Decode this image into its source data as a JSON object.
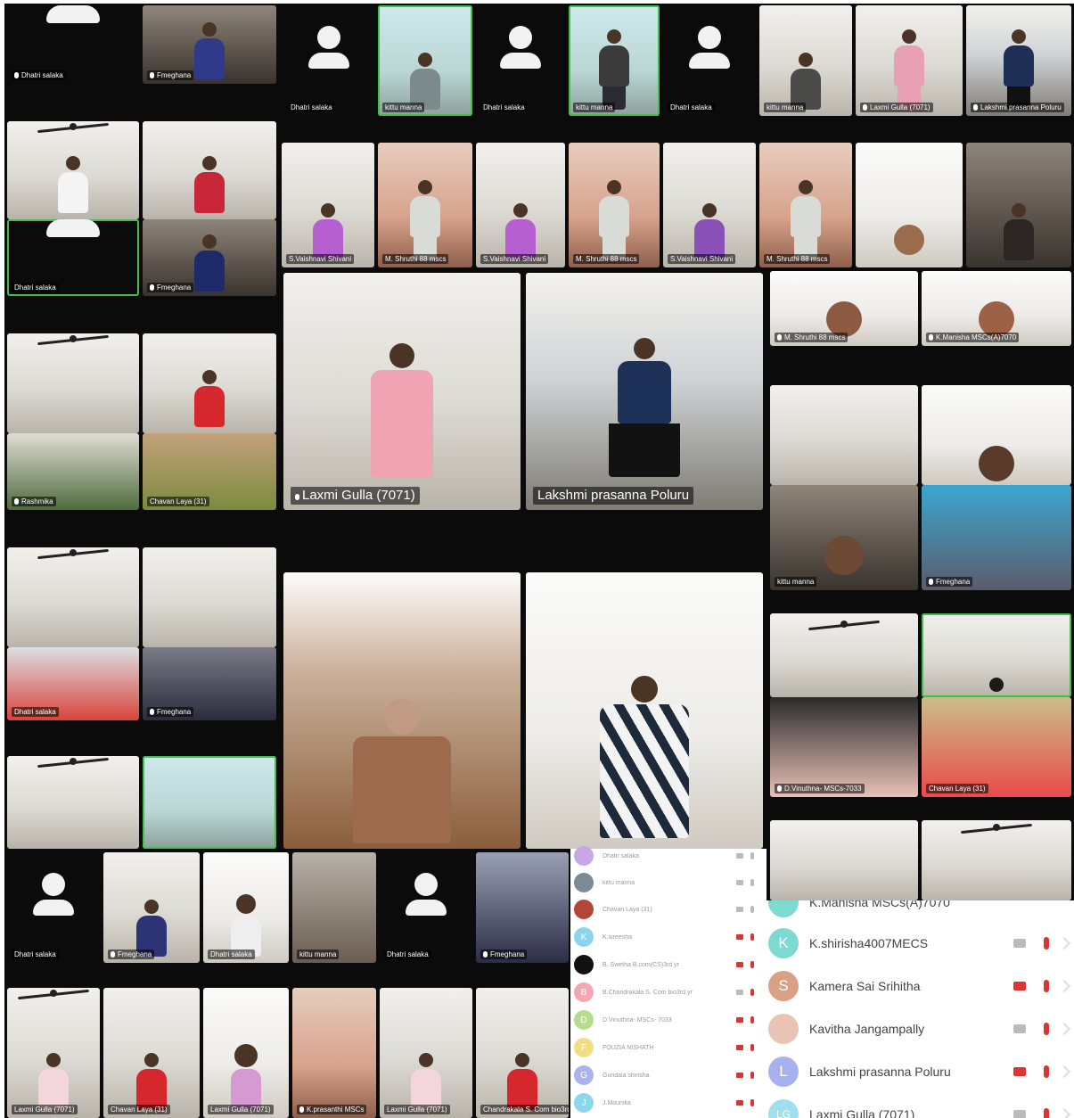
{
  "tiles": {
    "a1": "Dhatri salaka",
    "a2": "Fmeghana",
    "b1": "Dhatri salaka",
    "b2": "kittu manna",
    "b3": "Dhatri salaka",
    "b4": "kittu manna",
    "b5": "Dhatri salaka",
    "b6": "kittu manna",
    "b7": "Laxmi Gulla (7071)",
    "b8": "Lakshmi prasanna Poluru",
    "c1": "Dhatri salaka",
    "c2": "Fmeghana",
    "d1": "S.Vaishnavi Shivani",
    "d2": "M. Shruthi 88 mscs",
    "d3": "S.Vaishnavi Shivani",
    "d4": "M. Shruthi 88 mscs",
    "d5": "S.Vaishnavi Shivani",
    "d6": "M. Shruthi 88 mscs",
    "e1": "M. Shruthi 88 mscs",
    "e2": "K.Manisha MSCs(A)7070",
    "f1": "Rashmika",
    "f2": "Chavan Laya (31)",
    "g1": "Laxmi Gulla (7071)",
    "g2": "Lakshmi prasanna Poluru",
    "h1": "kittu manna",
    "h2": "Fmeghana",
    "i1": "Dhatri salaka",
    "i2": "Fmeghana",
    "j1": "D.Vinuthna- MSCs-7033",
    "j2": "Chavan Laya (31)",
    "k1": "Dhatri salaka",
    "k2": "Fmeghana",
    "k3": "Dhatri salaka",
    "k4": "kittu manna",
    "k5": "Dhatri salaka",
    "k6": "Fmeghana",
    "m1": "Laxmi Gulla (7071)",
    "m2": "Chavan Laya (31)",
    "m3": "Laxmi Gulla (7071)",
    "m4": "K.prasanthi MSCs",
    "m5": "Laxmi Gulla (7071)",
    "m6": "Chandrakala S. Com bio3rd yr"
  },
  "small_list": [
    {
      "name": "Dhatri salaka",
      "color": "#c9a7e6",
      "initial": ""
    },
    {
      "name": "kittu manna",
      "color": "#7b8a96",
      "initial": ""
    },
    {
      "name": "Chavan Laya (31)",
      "color": "#b5453a",
      "initial": ""
    },
    {
      "name": "K.sireesha",
      "color": "#8ad4ef",
      "initial": "K"
    },
    {
      "name": "B. Swetha B.com(CS)3rd yr",
      "color": "#111111",
      "initial": ""
    },
    {
      "name": "B.Chandrakala S. Com bio3rd yr",
      "color": "#f3a6b4",
      "initial": "B"
    },
    {
      "name": "D.Vinuthna- MSCs- 7033",
      "color": "#b6dd8e",
      "initial": "D"
    },
    {
      "name": "FOUZIA NISHATH",
      "color": "#f2dc86",
      "initial": "F"
    },
    {
      "name": "Gundala shirisha",
      "color": "#a9b4ee",
      "initial": "G"
    },
    {
      "name": "J.Mounika",
      "color": "#8dd6f0",
      "initial": "J"
    }
  ],
  "big_list": [
    {
      "name": "K.Manisha MSCs(A)7070",
      "color": "#7ed9d1",
      "initial": "",
      "cam_on": false
    },
    {
      "name": "K.shirisha4007MECS",
      "color": "#7ed9d1",
      "initial": "K",
      "cam_on": false
    },
    {
      "name": "Kamera Sai Srihitha",
      "color": "#d9a184",
      "initial": "S",
      "cam_on": true
    },
    {
      "name": "Kavitha Jangampally",
      "color": "#e9c3b3",
      "initial": "",
      "cam_on": false
    },
    {
      "name": "Lakshmi prasanna Poluru",
      "color": "#a6b2f0",
      "initial": "L",
      "cam_on": true
    },
    {
      "name": "Laxmi Gulla (7071)",
      "color": "#9fe0ee",
      "initial": "LG",
      "cam_on": false
    }
  ]
}
